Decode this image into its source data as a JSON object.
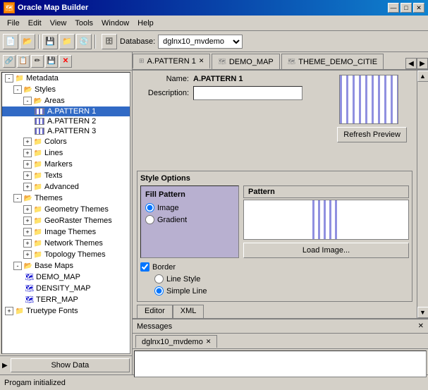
{
  "titleBar": {
    "title": "Oracle Map Builder",
    "minBtn": "—",
    "maxBtn": "□",
    "closeBtn": "✕"
  },
  "menuBar": {
    "items": [
      "File",
      "Edit",
      "View",
      "Tools",
      "Window",
      "Help"
    ]
  },
  "toolbar": {
    "dbLabel": "Database:",
    "dbValue": "dglnx10_mvdemo"
  },
  "tabs": {
    "active": "A.PATTERN 1",
    "items": [
      {
        "label": "A.PATTERN 1",
        "closable": true
      },
      {
        "label": "DEMO_MAP",
        "closable": false
      },
      {
        "label": "THEME_DEMO_CITIE",
        "closable": false
      }
    ]
  },
  "nameField": {
    "label": "Name:",
    "value": "A.PATTERN 1"
  },
  "descriptionField": {
    "label": "Description:",
    "value": ""
  },
  "refreshBtn": "Refresh Preview",
  "styleOptions": {
    "title": "Style Options",
    "fillPattern": {
      "title": "Fill Pattern",
      "options": [
        {
          "label": "Image",
          "checked": true
        },
        {
          "label": "Gradient",
          "checked": false
        }
      ]
    },
    "patternLabel": "Pattern",
    "loadImageBtn": "Load Image...",
    "border": {
      "label": "Border",
      "checked": true,
      "options": [
        {
          "label": "Line Style",
          "checked": false
        },
        {
          "label": "Simple Line",
          "checked": true
        }
      ]
    }
  },
  "editorTabs": [
    {
      "label": "Editor",
      "active": true
    },
    {
      "label": "XML",
      "active": false
    }
  ],
  "messages": {
    "title": "Messages",
    "tabs": [
      {
        "label": "dglnx10_mvdemo",
        "closable": true
      }
    ]
  },
  "statusBar": {
    "text": "Progam initialized"
  },
  "tree": {
    "showDataBtn": "Show Data",
    "nodes": [
      {
        "level": 0,
        "type": "folder-open",
        "label": "Metadata",
        "expanded": true,
        "id": "metadata"
      },
      {
        "level": 1,
        "type": "folder-open",
        "label": "Styles",
        "expanded": true,
        "id": "styles"
      },
      {
        "level": 2,
        "type": "folder-open",
        "label": "Areas",
        "expanded": true,
        "id": "areas"
      },
      {
        "level": 3,
        "type": "pattern",
        "label": "A.PATTERN 1",
        "selected": true,
        "id": "pattern1"
      },
      {
        "level": 3,
        "type": "pattern",
        "label": "A.PATTERN 2",
        "selected": false,
        "id": "pattern2"
      },
      {
        "level": 3,
        "type": "pattern",
        "label": "A.PATTERN 3",
        "selected": false,
        "id": "pattern3"
      },
      {
        "level": 2,
        "type": "folder",
        "label": "Colors",
        "expanded": false,
        "id": "colors"
      },
      {
        "level": 2,
        "type": "folder",
        "label": "Lines",
        "expanded": false,
        "id": "lines"
      },
      {
        "level": 2,
        "type": "folder",
        "label": "Markers",
        "expanded": false,
        "id": "markers"
      },
      {
        "level": 2,
        "type": "folder",
        "label": "Texts",
        "expanded": false,
        "id": "texts"
      },
      {
        "level": 2,
        "type": "folder",
        "label": "Advanced",
        "expanded": false,
        "id": "advanced"
      },
      {
        "level": 1,
        "type": "folder-open",
        "label": "Themes",
        "expanded": true,
        "id": "themes"
      },
      {
        "level": 2,
        "type": "folder",
        "label": "Geometry Themes",
        "expanded": false,
        "id": "geo-themes"
      },
      {
        "level": 2,
        "type": "folder",
        "label": "GeoRaster Themes",
        "expanded": false,
        "id": "georaster-themes"
      },
      {
        "level": 2,
        "type": "folder",
        "label": "Image Themes",
        "expanded": false,
        "id": "image-themes"
      },
      {
        "level": 2,
        "type": "folder",
        "label": "Network Themes",
        "expanded": false,
        "id": "network-themes"
      },
      {
        "level": 2,
        "type": "folder",
        "label": "Topology Themes",
        "expanded": false,
        "id": "topology-themes"
      },
      {
        "level": 1,
        "type": "folder-open",
        "label": "Base Maps",
        "expanded": true,
        "id": "basemaps"
      },
      {
        "level": 2,
        "type": "map",
        "label": "DEMO_MAP",
        "id": "demo-map"
      },
      {
        "level": 2,
        "type": "map",
        "label": "DENSITY_MAP",
        "id": "density-map"
      },
      {
        "level": 2,
        "type": "map",
        "label": "TERR_MAP",
        "id": "terr-map"
      },
      {
        "level": 0,
        "type": "folder",
        "label": "Truetype Fonts",
        "expanded": false,
        "id": "fonts"
      }
    ]
  }
}
